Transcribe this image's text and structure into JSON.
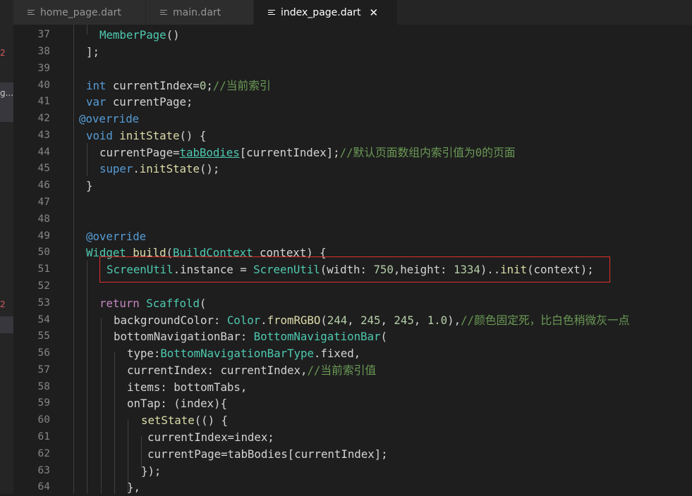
{
  "tabs": [
    {
      "label": "home_page.dart",
      "active": false
    },
    {
      "label": "main.dart",
      "active": false
    },
    {
      "label": "index_page.dart",
      "active": true
    }
  ],
  "close_glyph": "✕",
  "sidebar_fragments": {
    "top_digit": "2",
    "middle_text": "g...",
    "lower_digit": "2"
  },
  "line_numbers": [
    "37",
    "38",
    "39",
    "40",
    "41",
    "42",
    "43",
    "44",
    "45",
    "46",
    "47",
    "48",
    "49",
    "50",
    "51",
    "52",
    "53",
    "54",
    "55",
    "56",
    "57",
    "58",
    "59",
    "60",
    "61",
    "62",
    "63",
    "64"
  ],
  "code": {
    "l37": {
      "cls": "MemberPage",
      "rest": "()"
    },
    "l38": {
      "text": "];"
    },
    "l40": {
      "kw": "int",
      "mid": " currentIndex=",
      "num": "0",
      "semi": ";",
      "comment": "//当前索引"
    },
    "l41": {
      "kw": "var",
      "rest": " currentPage;"
    },
    "l42": {
      "ann": "@override"
    },
    "l43": {
      "kw": "void",
      "fn": " initState",
      "rest": "() {"
    },
    "l44": {
      "pre": "currentPage=",
      "link": "tabBodies",
      "rest": "[currentIndex];",
      "comment": "//默认页面数组内索引值为0的页面"
    },
    "l45": {
      "kw": "super",
      "dot": ".",
      "fn": "initState",
      "rest": "();"
    },
    "l46": {
      "text": "}"
    },
    "l49": {
      "ann": "@override"
    },
    "l50": {
      "ty": "Widget",
      "fn": " build",
      "p1": "(",
      "ty2": "BuildContext",
      "rest": " context) {"
    },
    "l51": {
      "ty": "ScreenUtil",
      "mid": ".instance = ",
      "ty2": "ScreenUtil",
      "p1": "(width: ",
      "n1": "750",
      "p2": ",height: ",
      "n2": "1334",
      "p3": ")..",
      "fn": "init",
      "rest": "(context);"
    },
    "l53": {
      "kw": "return",
      "sp": " ",
      "ty": "Scaffold",
      "rest": "("
    },
    "l54": {
      "pre": "backgroundColor: ",
      "ty": "Color",
      "dot": ".",
      "fn": "fromRGBO",
      "p1": "(",
      "n1": "244",
      "c1": ", ",
      "n2": "245",
      "c2": ", ",
      "n3": "245",
      "c3": ", ",
      "n4": "1.0",
      "p2": "),",
      "comment": "//颜色固定死，比白色稍微灰一点"
    },
    "l55": {
      "pre": "bottomNavigationBar: ",
      "ty": "BottomNavigationBar",
      "rest": "("
    },
    "l56": {
      "pre": "type:",
      "ty": "BottomNavigationBarType",
      "rest": ".fixed,"
    },
    "l57": {
      "pre": "currentIndex: currentIndex,",
      "comment": "//当前索引值"
    },
    "l58": {
      "text": "items: bottomTabs,"
    },
    "l59": {
      "text": "onTap: (index){"
    },
    "l60": {
      "fn": "setState",
      "rest": "(() {"
    },
    "l61": {
      "text": "currentIndex=index;"
    },
    "l62": {
      "text": "currentPage=tabBodies[currentIndex];"
    },
    "l63": {
      "text": "});"
    },
    "l64": {
      "text": "},"
    }
  },
  "colors": {
    "editor_bg": "#1e1e1e",
    "keyword": "#569cd6",
    "type": "#4ec9b0",
    "function": "#dcdcaa",
    "number": "#b5cea8",
    "comment": "#6a9955",
    "highlight_border": "#e0302e"
  }
}
